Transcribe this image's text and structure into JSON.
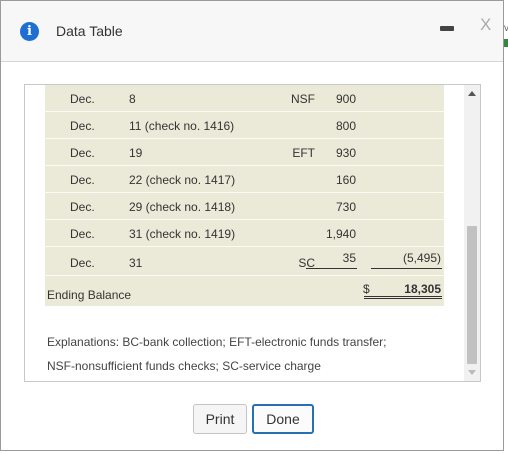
{
  "dialog": {
    "title": "Data Table",
    "info_glyph": "i",
    "close_glyph": "X",
    "side_glyph": "v",
    "icons": [
      "info-icon",
      "minimize-icon",
      "close-icon",
      "chevron-up-icon",
      "chevron-down-icon"
    ]
  },
  "rows": [
    {
      "month": "Dec.",
      "item": "8",
      "code": "NSF",
      "amount": "900",
      "balance": ""
    },
    {
      "month": "Dec.",
      "item": "11 (check no. 1416)",
      "code": "",
      "amount": "800",
      "balance": ""
    },
    {
      "month": "Dec.",
      "item": "19",
      "code": "EFT",
      "amount": "930",
      "balance": ""
    },
    {
      "month": "Dec.",
      "item": "22 (check no. 1417)",
      "code": "",
      "amount": "160",
      "balance": ""
    },
    {
      "month": "Dec.",
      "item": "29 (check no. 1418)",
      "code": "",
      "amount": "730",
      "balance": ""
    },
    {
      "month": "Dec.",
      "item": "31 (check no. 1419)",
      "code": "",
      "amount": "1,940",
      "balance": ""
    },
    {
      "month": "Dec.",
      "item": "31",
      "code": "SC",
      "amount": "35",
      "balance": "(5,495)"
    }
  ],
  "ending": {
    "label": "Ending Balance",
    "currency": "$",
    "value": "18,305"
  },
  "explanations": {
    "line1": "Explanations: BC-bank collection; EFT-electronic funds transfer;",
    "line2": "NSF-nonsufficient funds checks; SC-service charge"
  },
  "buttons": {
    "print": "Print",
    "done": "Done"
  },
  "colors": {
    "row_bg": "#ebead9",
    "accent": "#2a6fb1",
    "info": "#1f6fd1"
  }
}
